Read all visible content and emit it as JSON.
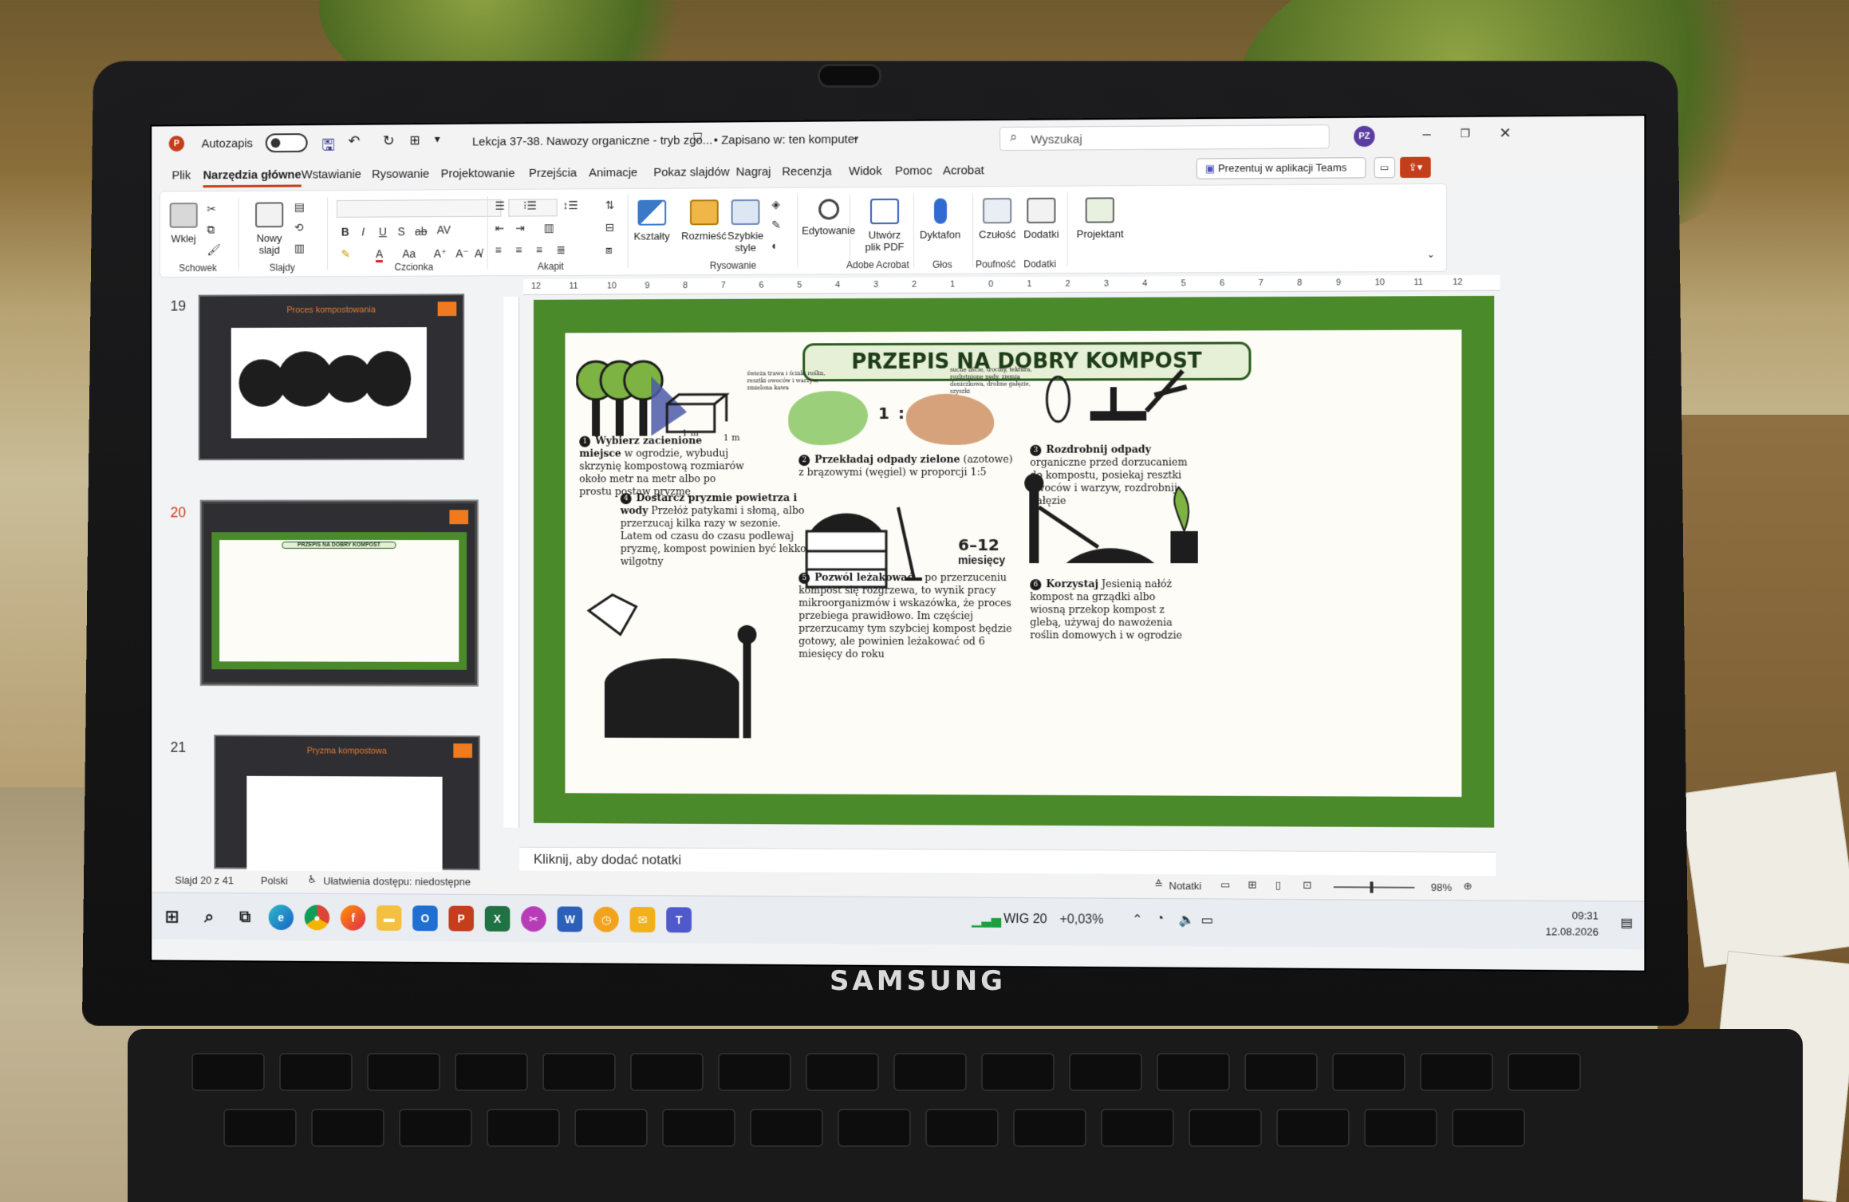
{
  "titlebar": {
    "autosave_label": "Autozapis",
    "doc_title": "Lekcja 37-38. Nawozy organiczne - tryb zgo...",
    "save_status": "• Zapisano w: ten komputer",
    "search_placeholder": "Wyszukaj",
    "avatar_initials": "PZ"
  },
  "menu": {
    "items": [
      "Plik",
      "Narzędzia główne",
      "Wstawianie",
      "Rysowanie",
      "Projektowanie",
      "Przejścia",
      "Animacje",
      "Pokaz slajdów",
      "Nagraj",
      "Recenzja",
      "Widok",
      "Pomoc",
      "Acrobat"
    ],
    "teams_label": "Prezentuj w aplikacji Teams"
  },
  "ribbon": {
    "paste": "Wklej",
    "new_slide": "Nowy slajd",
    "shapes": "Kształty",
    "arrange": "Rozmieść",
    "quick_styles": "Szybkie style",
    "editing": "Edytowanie",
    "create_pdf": "Utwórz plik PDF",
    "dictate": "Dyktafon",
    "sensitivity": "Czułość",
    "addins": "Dodatki",
    "designer": "Projektant",
    "groups": {
      "clipboard": "Schowek",
      "slides": "Slajdy",
      "font": "Czcionka",
      "paragraph": "Akapit",
      "drawing": "Rysowanie",
      "adobe": "Adobe Acrobat",
      "voice": "Głos",
      "sensitivity": "Poufność",
      "addins": "Dodatki"
    }
  },
  "thumbnails": [
    {
      "num": "19",
      "title": "Proces kompostowania"
    },
    {
      "num": "20",
      "title": "PRZEPIS NA DOBRY KOMPOST"
    },
    {
      "num": "21",
      "title": "Pryzma kompostowa"
    }
  ],
  "ruler": [
    "12",
    "11",
    "10",
    "9",
    "8",
    "7",
    "6",
    "5",
    "4",
    "3",
    "2",
    "1",
    "0",
    "1",
    "2",
    "3",
    "4",
    "5",
    "6",
    "7",
    "8",
    "9",
    "10",
    "11",
    "12"
  ],
  "slide": {
    "title": "PRZEPIS NA DOBRY KOMPOST",
    "dim_a": "1 m",
    "dim_b": "1 m",
    "ratio": "1 : 5",
    "months_num": "6–12",
    "months_word": "miesięcy",
    "green_tiny": "świeża trawa i ścinki roślin, resztki owoców i warzyw, zmielona kawa",
    "brown_tiny": "suche liście, trociny, tektura, rozlistnione pędy, ziemia doniczkowa, drobne gałęzie, szyszki",
    "step1_head": "Wybierz zacienione miejsce",
    "step1_body": "w ogrodzie, wybuduj skrzynię kompostową rozmiarów około metr na metr albo po prostu postaw pryzmę",
    "step2_head": "Przekładaj odpady zielone",
    "step2_body": "(azotowe) z brązowymi (węgiel) w proporcji 1:5",
    "step3_head": "Rozdrobnij odpady",
    "step3_body": "organiczne przed dorzucaniem do kompostu, posiekaj resztki owoców i warzyw, rozdrobnij gałęzie",
    "step4_head": "Dostarcz pryzmie powietrza i wody",
    "step4_body": "Przełóż patykami i słomą, albo przerzucaj kilka razy w sezonie. Latem od czasu do czasu podlewaj pryzmę, kompost powinien być lekko wilgotny",
    "step5_head": "Pozwól leżakować",
    "step5_body": "– po przerzuceniu kompost się rozgrzewa, to wynik pracy mikroorganizmów i wskazówka, że proces przebiega prawidłowo. Im częściej przerzucamy tym szybciej kompost będzie gotowy, ale powinien leżakować od 6 miesięcy do roku",
    "step6_head": "Korzystaj",
    "step6_body": "Jesienią nałóż kompost na grządki albo wiosną przekop kompost z glebą, używaj do nawożenia roślin domowych i w ogrodzie"
  },
  "notes_placeholder": "Kliknij, aby dodać notatki",
  "status": {
    "slide_count": "Slajd 20 z 41",
    "language": "Polski",
    "accessibility": "Ułatwienia dostępu: niedostępne",
    "notes": "Notatki",
    "zoom": "98%"
  },
  "taskbar": {
    "stock_name": "WIG 20",
    "stock_change": "+0,03%",
    "time": "09:31",
    "date": "12.08.2026"
  },
  "hardware": {
    "brand": "SAMSUNG"
  },
  "colors": {
    "ppt_accent": "#c43e1c",
    "slide_green": "#4a8a2a",
    "title_dark_green": "#1d3b16"
  }
}
